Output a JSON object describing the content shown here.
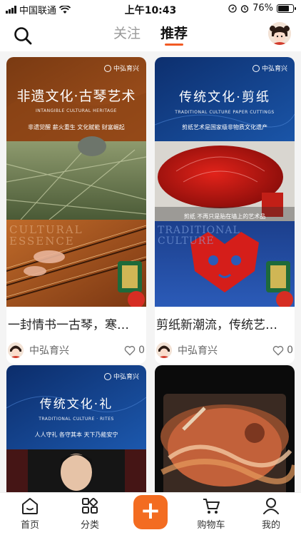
{
  "status_bar": {
    "carrier": "中国联通",
    "time": "上午10:43",
    "battery": "76%",
    "battery_level": 0.76
  },
  "header": {
    "tabs": [
      {
        "label": "关注",
        "active": false
      },
      {
        "label": "推荐",
        "active": true
      }
    ]
  },
  "feed": {
    "cards": [
      {
        "banner": {
          "title": "非遗文化·古琴艺术",
          "subtitle": "INTANGIBLE CULTURAL HERITAGE",
          "tagline": "非遗觉醒 薪火重生 文化赋能 财富崛起",
          "brand": "中弘育兴",
          "watermark": "CULTURAL ESSENCE"
        },
        "title": "一封情书一古琴，寒…",
        "author": "中弘育兴",
        "likes": "0"
      },
      {
        "banner": {
          "title": "传统文化·剪纸",
          "subtitle": "TRADITIONAL CULTURE PAPER CUTTINGS",
          "tagline": "剪纸艺术是国家级非物质文化遗产",
          "brand": "中弘育兴",
          "caption": "剪纸 不再只是贴在墙上的艺术品",
          "watermark": "TRADITIONAL CULTURE"
        },
        "title": "剪纸新潮流，传统艺…",
        "author": "中弘育兴",
        "likes": "0"
      },
      {
        "banner": {
          "title": "传统文化·礼",
          "subtitle": "TRADITIONAL CULTURE · RITES",
          "tagline": "人人守礼 各守其本 天下乃能安宁",
          "brand": "中弘育兴"
        }
      },
      {}
    ]
  },
  "bottom_nav": {
    "items": [
      {
        "label": "首页",
        "icon": "home-icon"
      },
      {
        "label": "分类",
        "icon": "grid-icon"
      },
      {
        "label": "+",
        "icon": "plus-icon"
      },
      {
        "label": "购物车",
        "icon": "cart-icon"
      },
      {
        "label": "我的",
        "icon": "user-icon"
      }
    ]
  },
  "colors": {
    "accent": "#f36c21",
    "tab_underline": "#f15a24"
  }
}
